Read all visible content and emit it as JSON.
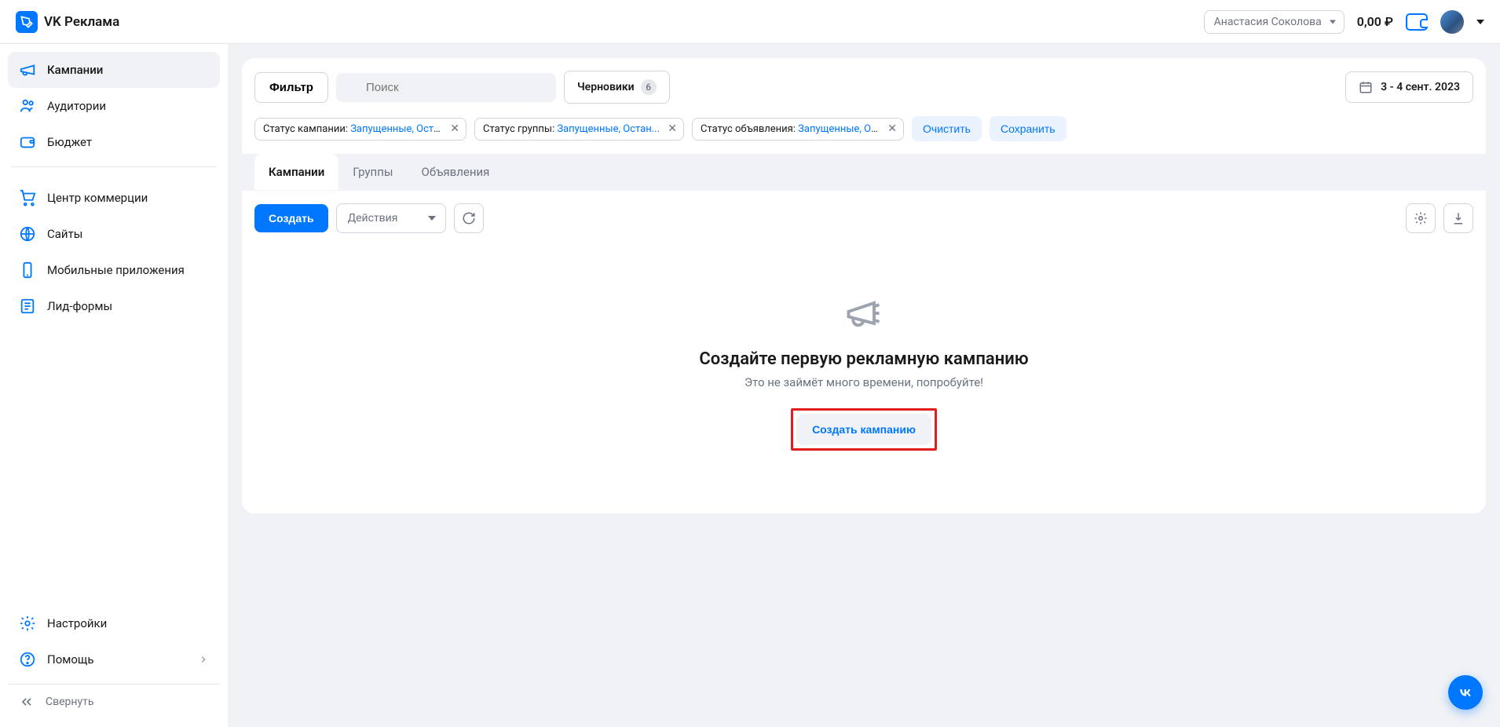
{
  "header": {
    "brand": "VK Реклама",
    "user_name": "Анастасия Соколова",
    "balance": "0,00 ₽"
  },
  "sidebar": {
    "items": [
      {
        "label": "Кампании",
        "icon": "megaphone"
      },
      {
        "label": "Аудитории",
        "icon": "users"
      },
      {
        "label": "Бюджет",
        "icon": "wallet"
      }
    ],
    "items2": [
      {
        "label": "Центр коммерции",
        "icon": "cart"
      },
      {
        "label": "Сайты",
        "icon": "globe"
      },
      {
        "label": "Мобильные приложения",
        "icon": "mobile"
      },
      {
        "label": "Лид-формы",
        "icon": "form"
      }
    ],
    "bottom": [
      {
        "label": "Настройки",
        "icon": "gear"
      },
      {
        "label": "Помощь",
        "icon": "help",
        "chevron": true
      }
    ],
    "collapse": "Свернуть"
  },
  "toolbar": {
    "filter": "Фильтр",
    "search_placeholder": "Поиск",
    "drafts": "Черновики",
    "drafts_count": "6",
    "date_range": "3 - 4 сент. 2023"
  },
  "filters": {
    "chips": [
      {
        "label": "Статус кампании:",
        "value": " Запущенные, Остан..."
      },
      {
        "label": "Статус группы:",
        "value": " Запущенные, Остан..."
      },
      {
        "label": "Статус объявления:",
        "value": " Запущенные, Остан..."
      }
    ],
    "clear": "Очистить",
    "save": "Сохранить"
  },
  "tabs": {
    "items": [
      "Кампании",
      "Группы",
      "Объявления"
    ]
  },
  "actions": {
    "create": "Создать",
    "actions_label": "Действия"
  },
  "empty": {
    "title": "Создайте первую рекламную кампанию",
    "subtitle": "Это не займёт много времени, попробуйте!",
    "cta": "Создать кампанию"
  },
  "fab": "VK"
}
